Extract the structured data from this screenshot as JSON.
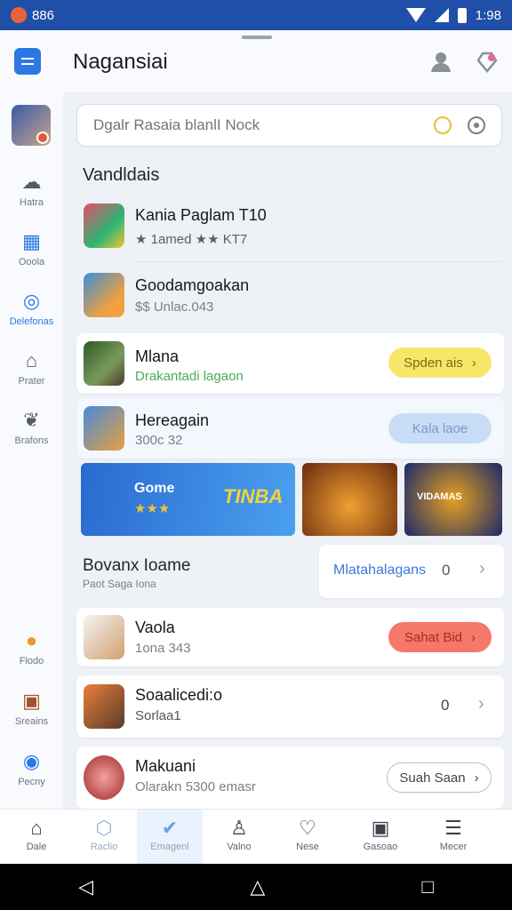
{
  "status": {
    "time_left": "886",
    "time_right": "1:98"
  },
  "appbar": {
    "title": "Nagansiai",
    "icons": [
      "menu-icon",
      "user-icon",
      "gift-icon"
    ]
  },
  "sidebar": {
    "items": [
      {
        "label": "Hatra",
        "icon": "cloud-icon"
      },
      {
        "label": "Ooola",
        "icon": "building-icon"
      },
      {
        "label": "Delefonas",
        "icon": "target-icon"
      },
      {
        "label": "Prater",
        "icon": "house-icon"
      },
      {
        "label": "Brafons",
        "icon": "leaf-icon"
      },
      {
        "label": "Flodo",
        "icon": "lion-icon"
      },
      {
        "label": "Sreains",
        "icon": "chest-icon"
      },
      {
        "label": "Pecny",
        "icon": "shield-icon"
      }
    ]
  },
  "search": {
    "placeholder": "Dgalr Rasaia blanlI Nock"
  },
  "section1": {
    "title": "Vandldais"
  },
  "list": [
    {
      "title": "Kania Paglam T10",
      "sub": "★ 1amed ★★ KT7"
    },
    {
      "title": "Goodamgoakan",
      "sub": "$$ Unlac.043"
    },
    {
      "title": "Mlana",
      "sub": "Drakantadi lagaon",
      "button": "Spden ais"
    },
    {
      "title": "Hereagain",
      "sub": "300c 32",
      "button": "Kala laoe"
    }
  ],
  "banners": [
    {
      "label": "Gome",
      "badge": "TINBA",
      "stars": "★★★"
    },
    {
      "label": ""
    },
    {
      "label": "VIDAMAS"
    }
  ],
  "section2": {
    "title": "Bovanx Ioame",
    "sub": "Paot Saga Iona",
    "side_button": "Mlatahalagans",
    "side_value": "0"
  },
  "list2": [
    {
      "title": "Vaola",
      "sub": "1ona 343",
      "button": "Sahat Bid"
    },
    {
      "title": "Soaalicedi:o",
      "sub": "Sorlaa1",
      "value": "0"
    },
    {
      "title": "Makuani",
      "sub": "Olarakn 5300 emasr",
      "button": "Suah Saan"
    }
  ],
  "bottom_nav": [
    {
      "label": "Dale",
      "icon": "home-icon"
    },
    {
      "label": "Raclio",
      "icon": "hexagon-icon"
    },
    {
      "label": "Emagenl",
      "icon": "check-badge-icon"
    },
    {
      "label": "Valno",
      "icon": "person-icon"
    },
    {
      "label": "Nese",
      "icon": "heart-icon"
    },
    {
      "label": "Gasoao",
      "icon": "image-icon"
    },
    {
      "label": "Mecer",
      "icon": "stack-icon"
    }
  ]
}
